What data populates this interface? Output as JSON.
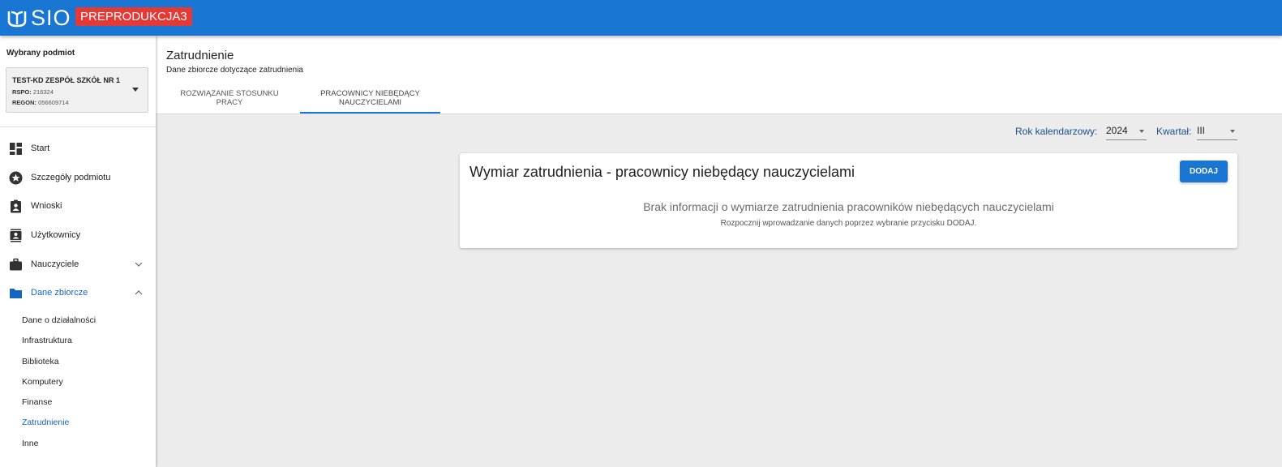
{
  "header": {
    "logo_text": "SIO",
    "environment_badge": "PREPRODUKCJA3",
    "brand_color": "#1976d2",
    "badge_color": "#e53935"
  },
  "sidebar": {
    "subject_label": "Wybrany podmiot",
    "subject": {
      "name": "TEST-KD ZESPÓŁ SZKÓŁ NR 1",
      "rspo_label": "RSPO:",
      "rspo_value": "216324",
      "regon_label": "REGON:",
      "regon_value": "056609714"
    },
    "items": [
      {
        "label": "Start",
        "icon": "dashboard-icon"
      },
      {
        "label": "Szczegóły podmiotu",
        "icon": "star-badge-icon"
      },
      {
        "label": "Wnioski",
        "icon": "clipboard-person-icon"
      },
      {
        "label": "Użytkownicy",
        "icon": "contacts-icon"
      },
      {
        "label": "Nauczyciele",
        "icon": "briefcase-icon",
        "expandable": true,
        "expanded": false
      },
      {
        "label": "Dane zbiorcze",
        "icon": "folder-icon",
        "expandable": true,
        "expanded": true,
        "active": true
      }
    ],
    "sub_items": [
      {
        "label": "Dane o działalności"
      },
      {
        "label": "Infrastruktura"
      },
      {
        "label": "Biblioteka"
      },
      {
        "label": "Komputery"
      },
      {
        "label": "Finanse"
      },
      {
        "label": "Zatrudnienie",
        "active": true
      },
      {
        "label": "Inne"
      }
    ]
  },
  "page": {
    "title": "Zatrudnienie",
    "subtitle": "Dane zbiorcze dotyczące zatrudnienia",
    "tabs": [
      {
        "line1": "ROZWIĄZANIE STOSUNKU",
        "line2": "PRACY",
        "active": false
      },
      {
        "line1": "PRACOWNICY NIEBĘDĄCY",
        "line2": "NAUCZYCIELAMI",
        "active": true
      }
    ]
  },
  "filters": {
    "year_label": "Rok kalendarzowy:",
    "year_value": "2024",
    "quarter_label": "Kwartał:",
    "quarter_value": "III"
  },
  "card": {
    "title": "Wymiar zatrudnienia - pracownicy niebędący nauczycielami",
    "add_button": "DODAJ",
    "empty_title": "Brak informacji o wymiarze zatrudnienia pracowników niebędących nauczycielami",
    "empty_hint": "Rozpocznij wprowadzanie danych poprzez wybranie przycisku DODAJ."
  }
}
